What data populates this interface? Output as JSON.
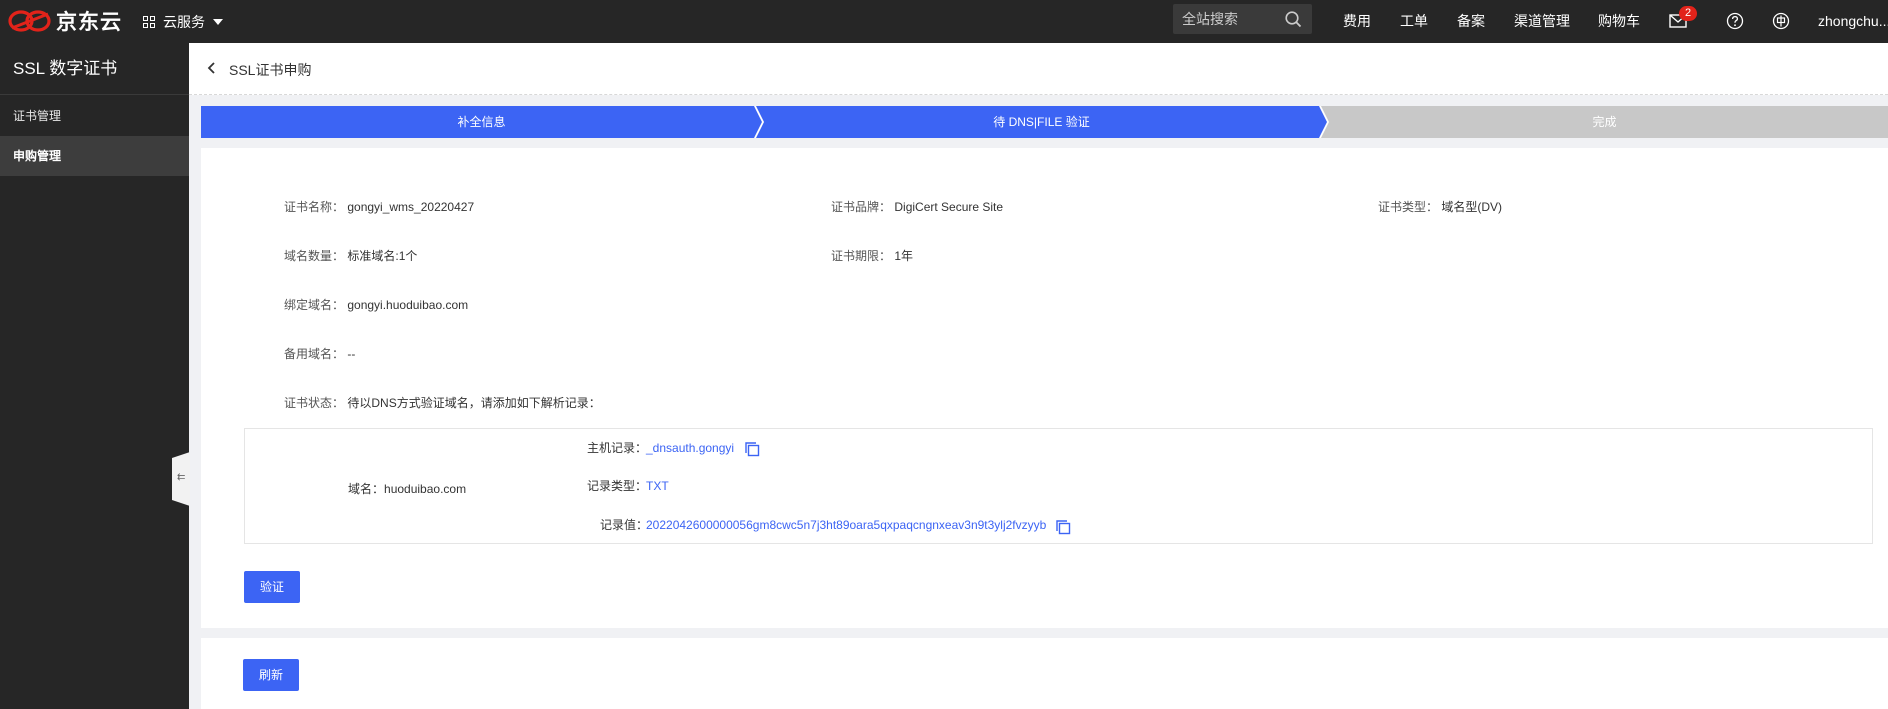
{
  "topnav": {
    "brand": "京东云",
    "cloud_menu": "云服务",
    "search_placeholder": "全站搜索",
    "links": [
      "费用",
      "工单",
      "备案",
      "渠道管理",
      "购物车"
    ],
    "message_count": "2",
    "username": "zhongchu..."
  },
  "sidebar": {
    "title": "SSL 数字证书",
    "items": [
      {
        "label": "证书管理",
        "active": false
      },
      {
        "label": "申购管理",
        "active": true
      }
    ],
    "collapse_glyph": "⇇"
  },
  "header": {
    "title": "SSL证书申购"
  },
  "steps": [
    "补全信息",
    "待 DNS|FILE 验证",
    "完成"
  ],
  "cert": {
    "name_label": "证书名称：",
    "name": "gongyi_wms_20220427",
    "brand_label": "证书品牌：",
    "brand": "DigiCert Secure Site",
    "type_label": "证书类型：",
    "type": "域名型(DV)",
    "count_label": "域名数量：",
    "count": "标准域名:1个",
    "period_label": "证书期限：",
    "period": "1年",
    "bound_label": "绑定域名：",
    "bound": "gongyi.huoduibao.com",
    "backup_label": "备用域名：",
    "backup": "--",
    "status_label": "证书状态：",
    "status": "待以DNS方式验证域名，请添加如下解析记录："
  },
  "dns": {
    "domain_label": "域名：",
    "domain": "huoduibao.com",
    "host_label": "主机记录：",
    "host": "_dnsauth.gongyi",
    "type_label": "记录类型：",
    "type": "TXT",
    "value_label": "记录值：",
    "value": "2022042600000056gm8cwc5n7j3ht89oara5qxpaqcngnxeav3n9t3ylj2fvzyyb"
  },
  "buttons": {
    "verify": "验证",
    "refresh": "刷新"
  },
  "colors": {
    "accent": "#3c64f4",
    "nav_bg": "#262626",
    "step_pending": "#c8c8c8",
    "logo_red": "#e2231a"
  }
}
